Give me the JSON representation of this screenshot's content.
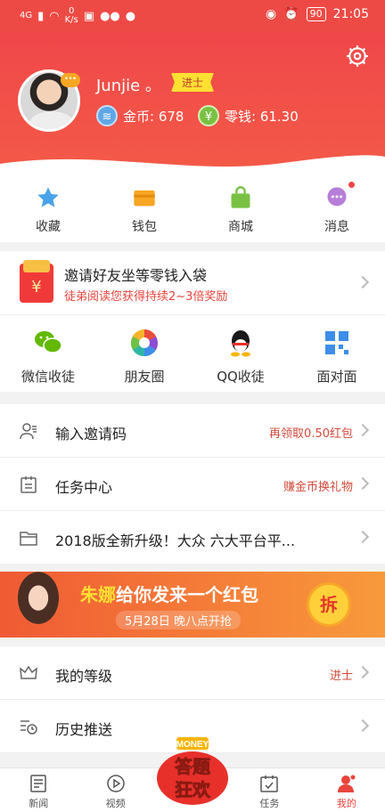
{
  "status": {
    "net": "4G",
    "speed_val": "0",
    "speed_unit": "K/s",
    "battery": "90",
    "time": "21:05"
  },
  "profile": {
    "username": "Junjie 。",
    "rank": "进士",
    "coins_label": "金币: 678",
    "money_label": "零钱: 61.30"
  },
  "quick": [
    {
      "label": "收藏",
      "icon": "star-icon"
    },
    {
      "label": "钱包",
      "icon": "wallet-icon"
    },
    {
      "label": "商城",
      "icon": "shop-bag-icon"
    },
    {
      "label": "消息",
      "icon": "message-icon"
    }
  ],
  "invite": {
    "title": "邀请好友坐等零钱入袋",
    "subtitle": "徒弟阅读您获得持续2~3倍奖励",
    "envelope_symbol": "¥"
  },
  "share": [
    {
      "label": "微信收徒",
      "icon": "wechat-icon"
    },
    {
      "label": "朋友圈",
      "icon": "moments-icon"
    },
    {
      "label": "QQ收徒",
      "icon": "qq-icon"
    },
    {
      "label": "面对面",
      "icon": "qrcode-icon"
    }
  ],
  "list": [
    {
      "label": "输入邀请码",
      "value": "再领取0.50红包",
      "icon": "user-invite-icon"
    },
    {
      "label": "任务中心",
      "value": "赚金币换礼物",
      "icon": "task-clipboard-icon"
    },
    {
      "label": "2018版全新升级！大众 六大平台平...",
      "value": "",
      "icon": "folder-icon"
    }
  ],
  "banner": {
    "name": "朱娜",
    "text": "给你发来一个红包",
    "sub": "5月28日 晚八点开抢",
    "badge": "拆"
  },
  "list2": [
    {
      "label": "我的等级",
      "value": "进士",
      "icon": "crown-icon"
    },
    {
      "label": "历史推送",
      "value": "",
      "icon": "history-icon"
    }
  ],
  "tabs": [
    {
      "label": "新闻",
      "icon": "news-icon"
    },
    {
      "label": "视频",
      "icon": "video-icon"
    },
    {
      "label": "",
      "icon": "quiz-icon"
    },
    {
      "label": "任务",
      "icon": "task-icon"
    },
    {
      "label": "我的",
      "icon": "me-icon"
    }
  ],
  "quiz": {
    "top": "MONEY",
    "line1": "答题",
    "line2": "狂欢"
  }
}
